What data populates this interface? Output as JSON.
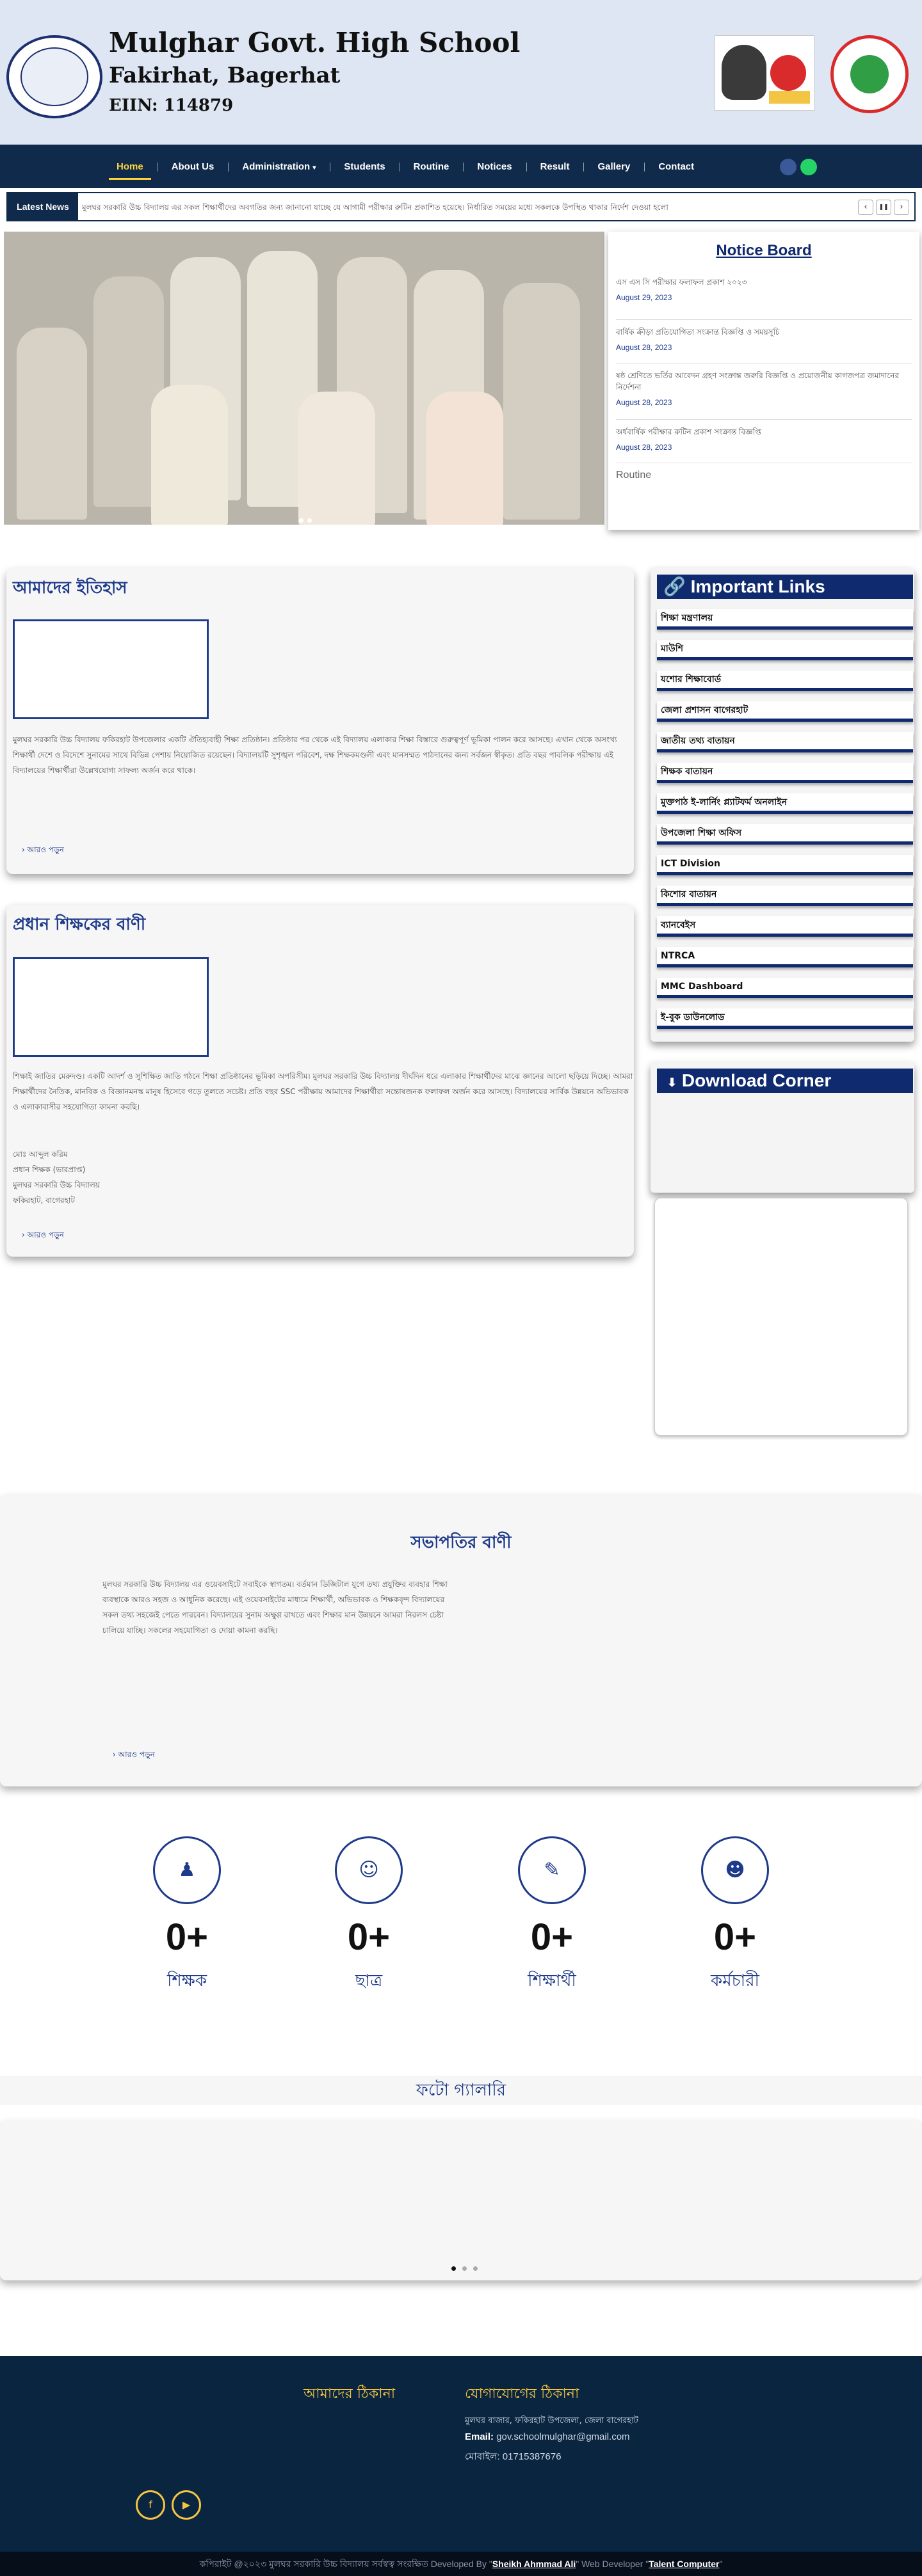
{
  "header": {
    "school_name": "Mulghar Govt. High School",
    "location": "Fakirhat, Bagerhat",
    "eiin": "EIIN: 114879"
  },
  "nav": {
    "items": [
      "Home",
      "About Us",
      "Administration",
      "Students",
      "Routine",
      "Notices",
      "Result",
      "Gallery",
      "Contact"
    ],
    "dropdown_icon": "chevron-down-icon"
  },
  "ticker": {
    "label": "Latest News",
    "message": "মুলঘর সরকারি উচ্চ বিদ্যালয় এর সকল শিক্ষার্থীদের অবগতির জন্য জানানো যাচ্ছে যে আগামী পরীক্ষার রুটিন প্রকাশিত হয়েছে। নির্ধারিত সময়ের মধ্যে সকলকে উপস্থিত থাকার নির্দেশ দেওয়া হলো",
    "prev": "‹",
    "pause": "❚❚",
    "next": "›"
  },
  "notice_board": {
    "title": "Notice Board",
    "items": [
      {
        "text": "এস এস সি পরীক্ষার ফলাফল প্রকাশ ২০২৩",
        "date": "August 29, 2023"
      },
      {
        "text": "বার্ষিক ক্রীড়া প্রতিযোগিতা সংক্রান্ত বিজ্ঞপ্তি ও সময়সূচি",
        "date": "August 28, 2023"
      },
      {
        "text": "ষষ্ঠ শ্রেণিতে ভর্তির আবেদন গ্রহণ সংক্রান্ত জরুরি বিজ্ঞপ্তি ও প্রয়োজনীয় কাগজপত্র জমাদানের নির্দেশনা",
        "date": "August 28, 2023"
      },
      {
        "text": "অর্ধবার্ষিক পরীক্ষার রুটিন প্রকাশ সংক্রান্ত বিজ্ঞপ্তি",
        "date": "August 28, 2023"
      }
    ],
    "footer": "Routine"
  },
  "history": {
    "title": "আমাদের ইতিহাস",
    "body": "মুলঘর সরকারি উচ্চ বিদ্যালয় ফকিরহাট উপজেলার একটি ঐতিহ্যবাহী শিক্ষা প্রতিষ্ঠান। প্রতিষ্ঠার পর থেকে এই বিদ্যালয় এলাকার শিক্ষা বিস্তারে গুরুত্বপূর্ণ ভূমিকা পালন করে আসছে। এখান থেকে অসংখ্য শিক্ষার্থী দেশে ও বিদেশে সুনামের সাথে বিভিন্ন পেশায় নিয়োজিত রয়েছেন। বিদ্যালয়টি সুশৃঙ্খল পরিবেশ, দক্ষ শিক্ষকমণ্ডলী এবং মানসম্মত পাঠদানের জন্য সর্বজন স্বীকৃত। প্রতি বছর পাবলিক পরীক্ষায় এই বিদ্যালয়ের শিক্ষার্থীরা উল্লেখযোগ্য সাফল্য অর্জন করে থাকে।",
    "more": "আরও পড়ুন"
  },
  "head_message": {
    "title": "প্রধান শিক্ষকের বাণী",
    "body": "শিক্ষাই জাতির মেরুদণ্ড। একটি আদর্শ ও সুশিক্ষিত জাতি গঠনে শিক্ষা প্রতিষ্ঠানের ভূমিকা অপরিসীম। মুলঘর সরকারি উচ্চ বিদ্যালয় দীর্ঘদিন ধরে এলাকার শিক্ষার্থীদের মাঝে জ্ঞানের আলো ছড়িয়ে দিচ্ছে। আমরা শিক্ষার্থীদের নৈতিক, মানবিক ও বিজ্ঞানমনস্ক মানুষ হিসেবে গড়ে তুলতে সচেষ্ট। প্রতি বছর SSC পরীক্ষায় আমাদের শিক্ষার্থীরা সন্তোষজনক ফলাফল অর্জন করে আসছে। বিদ্যালয়ের সার্বিক উন্নয়নে অভিভাবক ও এলাকাবাসীর সহযোগিতা কামনা করছি।",
    "sign": [
      "মোঃ আব্দুল করিম",
      "প্রধান শিক্ষক (ভারপ্রাপ্ত)",
      "মুলঘর সরকারি উচ্চ বিদ্যালয়",
      "ফকিরহাট, বাগেরহাট"
    ],
    "more": "আরও পড়ুন"
  },
  "important_links": {
    "title": "Important Links",
    "icon": "link-icon",
    "items": [
      "শিক্ষা মন্ত্রণালয়",
      "মাউশি",
      "যশোর শিক্ষাবোর্ড",
      "জেলা প্রশাসন বাগেরহাট",
      "জাতীয় তথ্য বাতায়ন",
      "শিক্ষক বাতায়ন",
      "মুক্তপাঠ ই-লার্নিং প্ল্যাটফর্ম অনলাইন",
      "উপজেলা শিক্ষা অফিস",
      "ICT Division",
      "কিশোর বাতায়ন",
      "ব্যানবেইস",
      "NTRCA",
      "MMC Dashboard",
      "ই-বুক ডাউনলোড"
    ]
  },
  "downloads": {
    "title": "Download Corner",
    "icon": "download-icon"
  },
  "chairman_message": {
    "title": "সভাপতির বাণী",
    "body": "মুলঘর সরকারি উচ্চ বিদ্যালয় এর ওয়েবসাইটে সবাইকে স্বাগতম। বর্তমান ডিজিটাল যুগে তথ্য প্রযুক্তির ব্যবহার শিক্ষা ব্যবস্থাকে আরও সহজ ও আধুনিক করেছে। এই ওয়েবসাইটের মাধ্যমে শিক্ষার্থী, অভিভাবক ও শিক্ষকবৃন্দ বিদ্যালয়ের সকল তথ্য সহজেই পেতে পারবেন। বিদ্যালয়ের সুনাম অক্ষুণ্ণ রাখতে এবং শিক্ষার মান উন্নয়নে আমরা নিরলস চেষ্টা চালিয়ে যাচ্ছি। সকলের সহযোগিতা ও দোয়া কামনা করছি।",
    "more": "আরও পড়ুন"
  },
  "counters": [
    {
      "icon": "teacher-icon",
      "value": "0+",
      "label": "শিক্ষক"
    },
    {
      "icon": "student-icon",
      "value": "0+",
      "label": "ছাত্র"
    },
    {
      "icon": "graduate-icon",
      "value": "0+",
      "label": "শিক্ষার্থী"
    },
    {
      "icon": "staff-icon",
      "value": "0+",
      "label": "কর্মচারী"
    }
  ],
  "photo_gallery": {
    "title": "ফটো গ্যালারি"
  },
  "footer": {
    "address_heading": "আমাদের ঠিকানা",
    "contact_heading": "যোগাযোগের ঠিকানা",
    "address": "মুলঘর বাজার, ফকিরহাট উপজেলা, জেলা বাগেরহাট",
    "email_label": "Email:",
    "email": "gov.schoolmulghar@gmail.com",
    "phone_label": "মোবাইল:",
    "phone": "01715387676",
    "social": [
      "facebook-icon",
      "youtube-icon"
    ]
  },
  "copyright": {
    "prefix": "কপিরাইট @২০২৩ মুলঘর সরকারি উচ্চ বিদ্যালয় সর্বস্বত্ব সংরক্ষিত Developed By",
    "developer": "Sheikh Ahmmad Ali",
    "middle": "Web Developer",
    "company": "Talent Computer"
  },
  "colors": {
    "primary": "#0f2a4a",
    "accent": "#ffd43b",
    "heading": "#1e3a8a"
  }
}
